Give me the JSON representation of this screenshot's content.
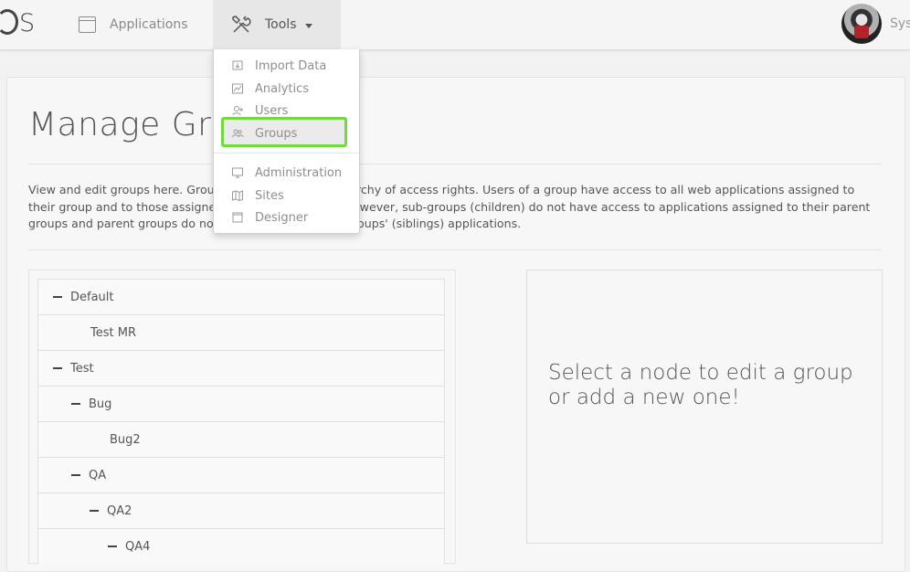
{
  "nav": {
    "logo_text": "S",
    "applications_label": "Applications",
    "tools_label": "Tools",
    "user_name": "Sys"
  },
  "page": {
    "title": "Manage Groups",
    "description": "View and edit groups here. Groups are ordered in a hierarchy of access rights. Users of a group have access to all web applications assigned to their group and to those assigned to their sub-groups. However, sub-groups (children) do not have access to applications assigned to their parent groups and parent groups do not have access to other groups' (siblings) applications."
  },
  "tree": {
    "nodes": [
      {
        "label": "Default",
        "expanded": true
      },
      {
        "label": "Test MR"
      },
      {
        "label": "Test",
        "expanded": true
      },
      {
        "label": "Bug",
        "expanded": true
      },
      {
        "label": "Bug2"
      },
      {
        "label": "QA",
        "expanded": true
      },
      {
        "label": "QA2",
        "expanded": true
      },
      {
        "label": "QA4"
      }
    ]
  },
  "info": {
    "message": "Select a node to edit a group or add a new one!"
  },
  "tools_menu": {
    "items": [
      {
        "label": "Import Data",
        "icon": "import-icon"
      },
      {
        "label": "Analytics",
        "icon": "chart-icon"
      },
      {
        "label": "Users",
        "icon": "user-plus-icon"
      },
      {
        "label": "Groups",
        "icon": "users-icon",
        "highlighted": true
      },
      {
        "label": "Administration",
        "icon": "monitor-icon"
      },
      {
        "label": "Sites",
        "icon": "map-icon"
      },
      {
        "label": "Designer",
        "icon": "square-icon"
      }
    ]
  },
  "colors": {
    "highlight_border": "#6fdb3c",
    "background": "#f2f2f2",
    "text": "#555555"
  }
}
